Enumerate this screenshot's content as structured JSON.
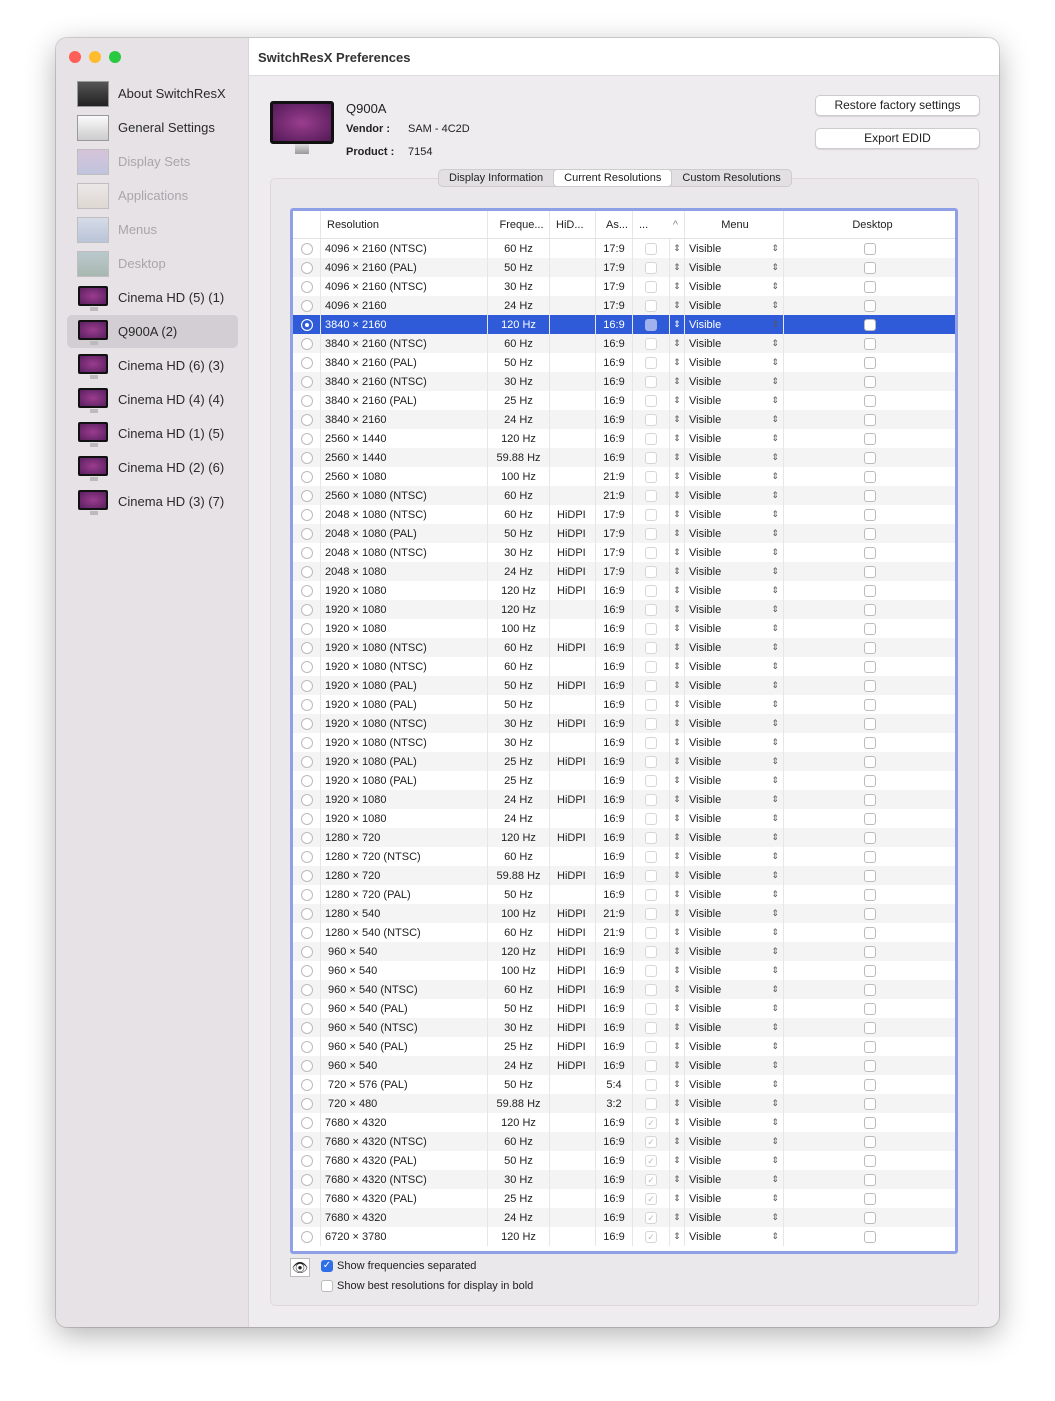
{
  "window": {
    "title": "SwitchResX Preferences"
  },
  "sidebar": {
    "items": [
      {
        "label": "About SwitchResX",
        "state": "normal",
        "icon": "gear-monitor-icon"
      },
      {
        "label": "General Settings",
        "state": "normal",
        "icon": "switch-icon"
      },
      {
        "label": "Display Sets",
        "state": "dim",
        "icon": "display-sets-icon"
      },
      {
        "label": "Applications",
        "state": "dim",
        "icon": "applications-icon"
      },
      {
        "label": "Menus",
        "state": "dim",
        "icon": "menus-icon"
      },
      {
        "label": "Desktop",
        "state": "dim",
        "icon": "desktop-icon"
      },
      {
        "label": "Cinema HD (5) (1)",
        "state": "normal",
        "icon": "monitor-icon"
      },
      {
        "label": "Q900A (2)",
        "state": "selected",
        "icon": "monitor-icon"
      },
      {
        "label": "Cinema HD (6) (3)",
        "state": "normal",
        "icon": "monitor-icon"
      },
      {
        "label": "Cinema HD (4) (4)",
        "state": "normal",
        "icon": "monitor-icon"
      },
      {
        "label": "Cinema HD (1) (5)",
        "state": "normal",
        "icon": "monitor-icon"
      },
      {
        "label": "Cinema HD (2) (6)",
        "state": "normal",
        "icon": "monitor-icon"
      },
      {
        "label": "Cinema HD (3) (7)",
        "state": "normal",
        "icon": "monitor-icon"
      }
    ]
  },
  "display": {
    "name": "Q900A",
    "vendor_label": "Vendor :",
    "vendor": "SAM - 4C2D",
    "product_label": "Product :",
    "product": "7154"
  },
  "buttons": {
    "restore": "Restore factory settings",
    "export": "Export EDID"
  },
  "tabs": [
    {
      "label": "Display Information",
      "active": false
    },
    {
      "label": "Current Resolutions",
      "active": true
    },
    {
      "label": "Custom Resolutions",
      "active": false
    }
  ],
  "table": {
    "headers": [
      "Resolution",
      "Freque...",
      "HiD...",
      "As...",
      "...",
      "Menu",
      "Desktop"
    ],
    "rows": [
      [
        "4096 × 2160 (NTSC)",
        "60 Hz",
        "",
        "17:9",
        false
      ],
      [
        "4096 × 2160 (PAL)",
        "50 Hz",
        "",
        "17:9",
        false
      ],
      [
        "4096 × 2160 (NTSC)",
        "30 Hz",
        "",
        "17:9",
        false
      ],
      [
        "4096 × 2160",
        "24 Hz",
        "",
        "17:9",
        false
      ],
      [
        "3840 × 2160",
        "120 Hz",
        "",
        "16:9",
        false
      ],
      [
        "3840 × 2160 (NTSC)",
        "60 Hz",
        "",
        "16:9",
        false
      ],
      [
        "3840 × 2160 (PAL)",
        "50 Hz",
        "",
        "16:9",
        false
      ],
      [
        "3840 × 2160 (NTSC)",
        "30 Hz",
        "",
        "16:9",
        false
      ],
      [
        "3840 × 2160 (PAL)",
        "25 Hz",
        "",
        "16:9",
        false
      ],
      [
        "3840 × 2160",
        "24 Hz",
        "",
        "16:9",
        false
      ],
      [
        "2560 × 1440",
        "120 Hz",
        "",
        "16:9",
        false
      ],
      [
        "2560 × 1440",
        "59.88 Hz",
        "",
        "16:9",
        false
      ],
      [
        "2560 × 1080",
        "100 Hz",
        "",
        "21:9",
        false
      ],
      [
        "2560 × 1080 (NTSC)",
        "60 Hz",
        "",
        "21:9",
        false
      ],
      [
        "2048 × 1080 (NTSC)",
        "60 Hz",
        "HiDPI",
        "17:9",
        false
      ],
      [
        "2048 × 1080 (PAL)",
        "50 Hz",
        "HiDPI",
        "17:9",
        false
      ],
      [
        "2048 × 1080 (NTSC)",
        "30 Hz",
        "HiDPI",
        "17:9",
        false
      ],
      [
        "2048 × 1080",
        "24 Hz",
        "HiDPI",
        "17:9",
        false
      ],
      [
        "1920 × 1080",
        "120 Hz",
        "HiDPI",
        "16:9",
        false
      ],
      [
        "1920 × 1080",
        "120 Hz",
        "",
        "16:9",
        false
      ],
      [
        "1920 × 1080",
        "100 Hz",
        "",
        "16:9",
        false
      ],
      [
        "1920 × 1080 (NTSC)",
        "60 Hz",
        "HiDPI",
        "16:9",
        false
      ],
      [
        "1920 × 1080 (NTSC)",
        "60 Hz",
        "",
        "16:9",
        false
      ],
      [
        "1920 × 1080 (PAL)",
        "50 Hz",
        "HiDPI",
        "16:9",
        false
      ],
      [
        "1920 × 1080 (PAL)",
        "50 Hz",
        "",
        "16:9",
        false
      ],
      [
        "1920 × 1080 (NTSC)",
        "30 Hz",
        "HiDPI",
        "16:9",
        false
      ],
      [
        "1920 × 1080 (NTSC)",
        "30 Hz",
        "",
        "16:9",
        false
      ],
      [
        "1920 × 1080 (PAL)",
        "25 Hz",
        "HiDPI",
        "16:9",
        false
      ],
      [
        "1920 × 1080 (PAL)",
        "25 Hz",
        "",
        "16:9",
        false
      ],
      [
        "1920 × 1080",
        "24 Hz",
        "HiDPI",
        "16:9",
        false
      ],
      [
        "1920 × 1080",
        "24 Hz",
        "",
        "16:9",
        false
      ],
      [
        "1280 × 720",
        "120 Hz",
        "HiDPI",
        "16:9",
        false
      ],
      [
        "1280 × 720 (NTSC)",
        "60 Hz",
        "",
        "16:9",
        false
      ],
      [
        "1280 × 720",
        "59.88 Hz",
        "HiDPI",
        "16:9",
        false
      ],
      [
        "1280 × 720 (PAL)",
        "50 Hz",
        "",
        "16:9",
        false
      ],
      [
        "1280 × 540",
        "100 Hz",
        "HiDPI",
        "21:9",
        false
      ],
      [
        "1280 × 540 (NTSC)",
        "60 Hz",
        "HiDPI",
        "21:9",
        false
      ],
      [
        " 960 × 540",
        "120 Hz",
        "HiDPI",
        "16:9",
        false
      ],
      [
        " 960 × 540",
        "100 Hz",
        "HiDPI",
        "16:9",
        false
      ],
      [
        " 960 × 540 (NTSC)",
        "60 Hz",
        "HiDPI",
        "16:9",
        false
      ],
      [
        " 960 × 540 (PAL)",
        "50 Hz",
        "HiDPI",
        "16:9",
        false
      ],
      [
        " 960 × 540 (NTSC)",
        "30 Hz",
        "HiDPI",
        "16:9",
        false
      ],
      [
        " 960 × 540 (PAL)",
        "25 Hz",
        "HiDPI",
        "16:9",
        false
      ],
      [
        " 960 × 540",
        "24 Hz",
        "HiDPI",
        "16:9",
        false
      ],
      [
        " 720 × 576 (PAL)",
        "50 Hz",
        "",
        "5:4",
        false
      ],
      [
        " 720 × 480",
        "59.88 Hz",
        "",
        "3:2",
        false
      ],
      [
        "7680 × 4320",
        "120 Hz",
        "",
        "16:9",
        true
      ],
      [
        "7680 × 4320 (NTSC)",
        "60 Hz",
        "",
        "16:9",
        true
      ],
      [
        "7680 × 4320 (PAL)",
        "50 Hz",
        "",
        "16:9",
        true
      ],
      [
        "7680 × 4320 (NTSC)",
        "30 Hz",
        "",
        "16:9",
        true
      ],
      [
        "7680 × 4320 (PAL)",
        "25 Hz",
        "",
        "16:9",
        true
      ],
      [
        "7680 × 4320",
        "24 Hz",
        "",
        "16:9",
        true
      ],
      [
        "6720 × 3780",
        "120 Hz",
        "",
        "16:9",
        true
      ]
    ],
    "selected_index": 4,
    "menu_value": "Visible"
  },
  "options": {
    "show_freq": "Show frequencies separated",
    "show_freq_checked": true,
    "show_bold": "Show best resolutions for display in bold",
    "show_bold_checked": false
  },
  "colors": {
    "accent": "#2f5bd8",
    "focus": "#8fa0e6"
  }
}
